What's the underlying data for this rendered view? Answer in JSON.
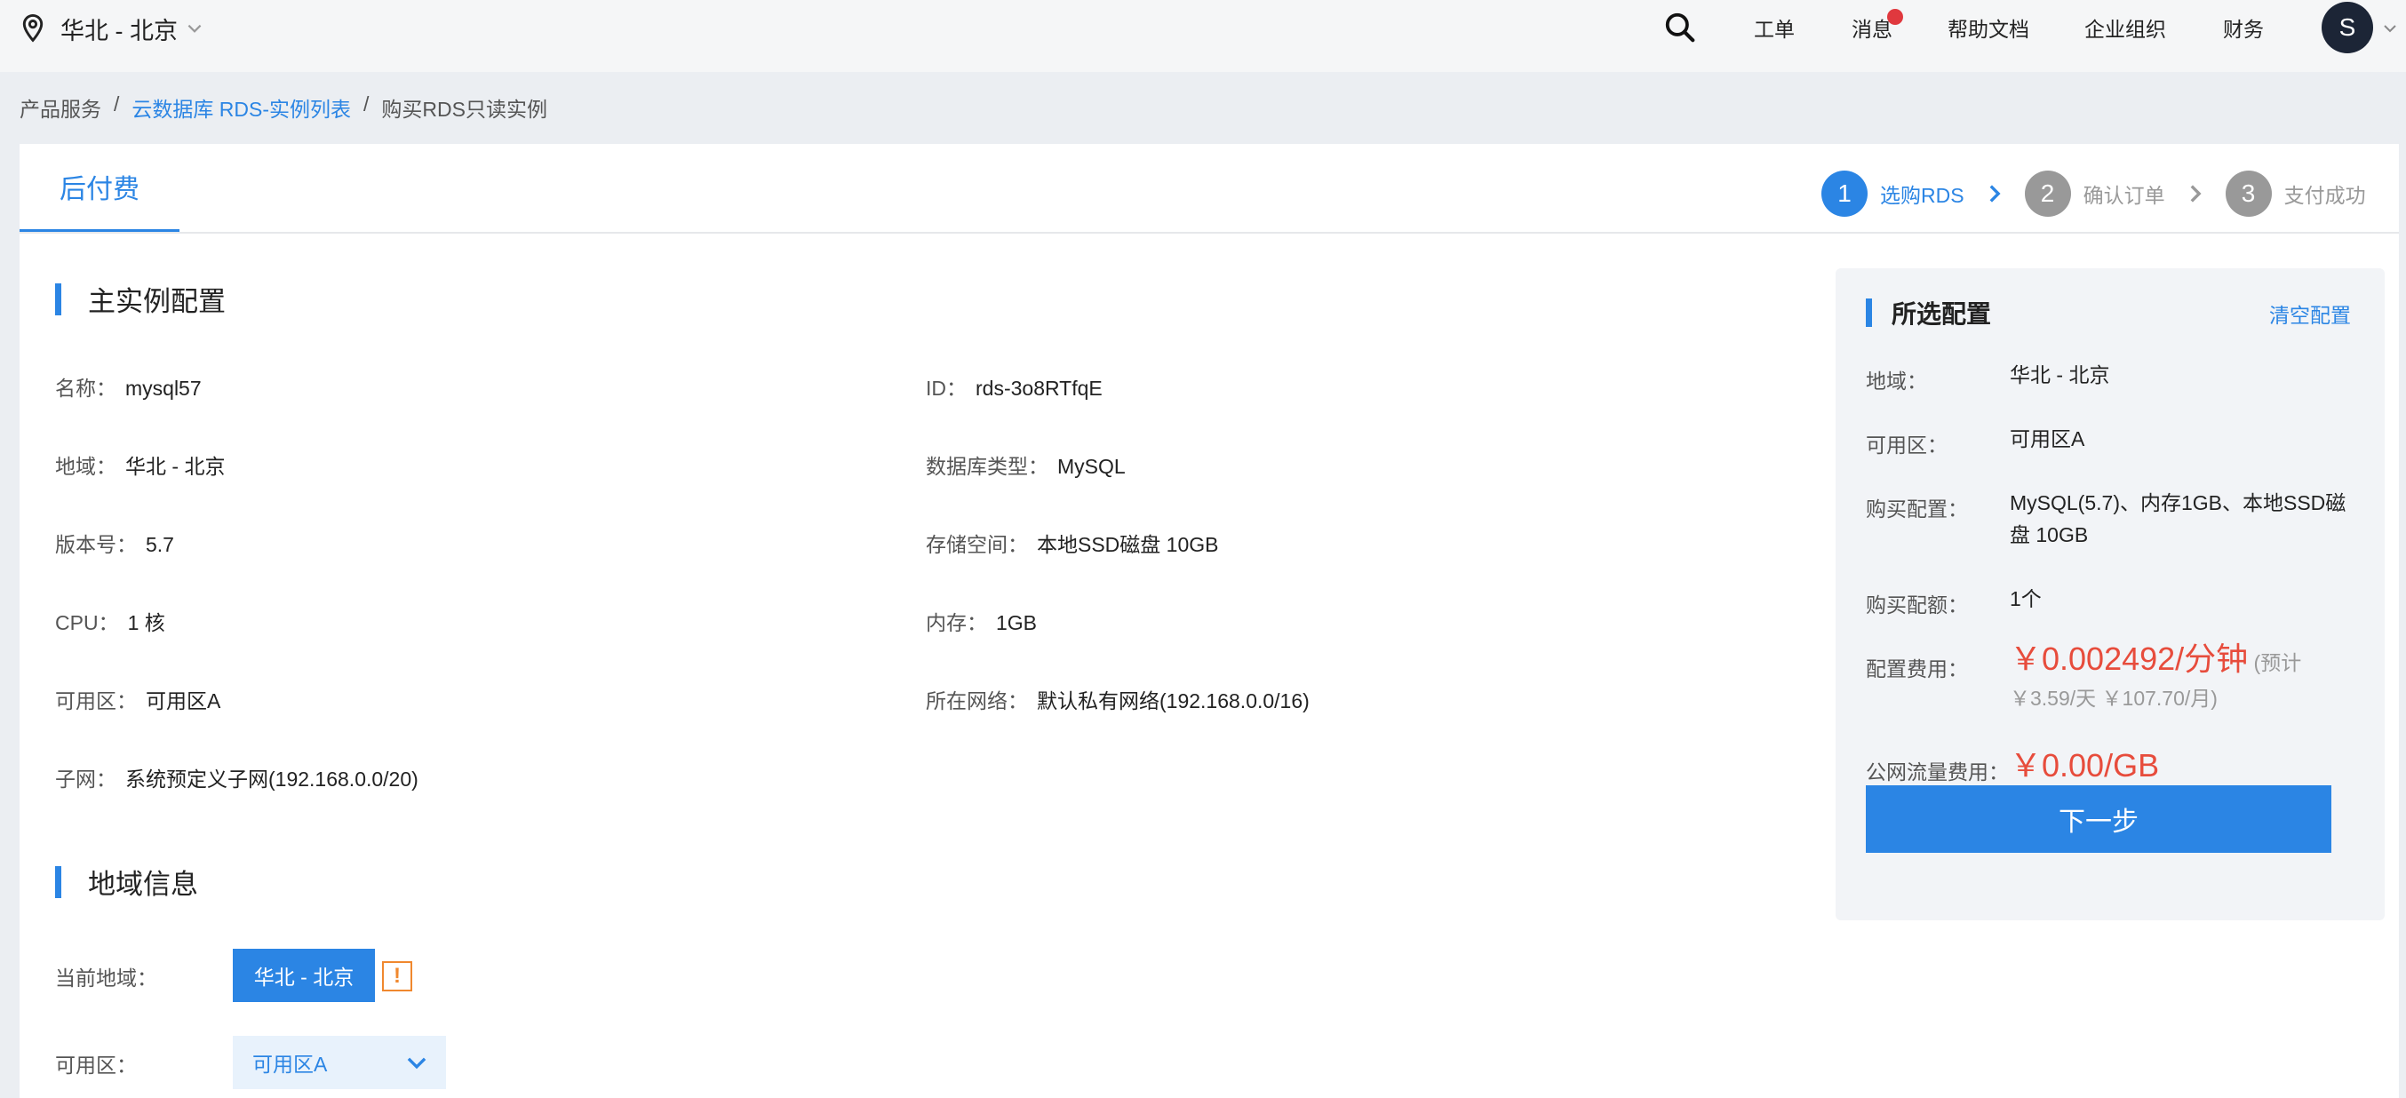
{
  "topbar": {
    "region": "华北 - 北京",
    "nav": [
      "工单",
      "消息",
      "帮助文档",
      "企业组织",
      "财务"
    ],
    "avatar_initial": "S",
    "badge_color": "#e0383e"
  },
  "breadcrumb": {
    "root": "产品服务",
    "sep": "/",
    "list": "云数据库 RDS-实例列表",
    "current": "购买RDS只读实例"
  },
  "tab": {
    "label": "后付费"
  },
  "steps": [
    {
      "num": "1",
      "label": "选购RDS",
      "active": true
    },
    {
      "num": "2",
      "label": "确认订单",
      "active": false
    },
    {
      "num": "3",
      "label": "支付成功",
      "active": false
    }
  ],
  "main": {
    "title": "主实例配置",
    "fields": [
      {
        "k": "名称：",
        "v": "mysql57"
      },
      {
        "k": "ID：",
        "v": "rds-3o8RTfqE"
      },
      {
        "k": "地域：",
        "v": "华北 - 北京"
      },
      {
        "k": "数据库类型：",
        "v": "MySQL"
      },
      {
        "k": "版本号：",
        "v": "5.7"
      },
      {
        "k": "存储空间：",
        "v": "本地SSD磁盘 10GB"
      },
      {
        "k": "CPU：",
        "v": "1 核"
      },
      {
        "k": "内存：",
        "v": "1GB"
      },
      {
        "k": "可用区：",
        "v": "可用区A"
      },
      {
        "k": "所在网络：",
        "v": "默认私有网络(192.168.0.0/16)"
      },
      {
        "k": "子网：",
        "v": "系统预定义子网(192.168.0.0/20)"
      }
    ]
  },
  "region_info": {
    "title": "地域信息",
    "current_label": "当前地域：",
    "current_value": "华北 - 北京",
    "warn": "!",
    "zone_label": "可用区：",
    "zone_value": "可用区A"
  },
  "summary": {
    "title": "所选配置",
    "clear": "清空配置",
    "region_label": "地域：",
    "region_value": "华北 - 北京",
    "zone_label": "可用区：",
    "zone_value": "可用区A",
    "config_label": "购买配置：",
    "config_value": "MySQL(5.7)、内存1GB、本地SSD磁盘 10GB",
    "quota_label": "购买配额：",
    "quota_value": "1个",
    "fee_label": "配置费用：",
    "fee_value": "￥0.002492/分钟",
    "fee_note": "(预计￥3.59/天 ￥107.70/月)",
    "traffic_label": "公网流量费用：",
    "traffic_value": "￥0.00/GB",
    "next": "下一步",
    "accent": "#2b85e4",
    "price_color": "#e74c3c"
  }
}
